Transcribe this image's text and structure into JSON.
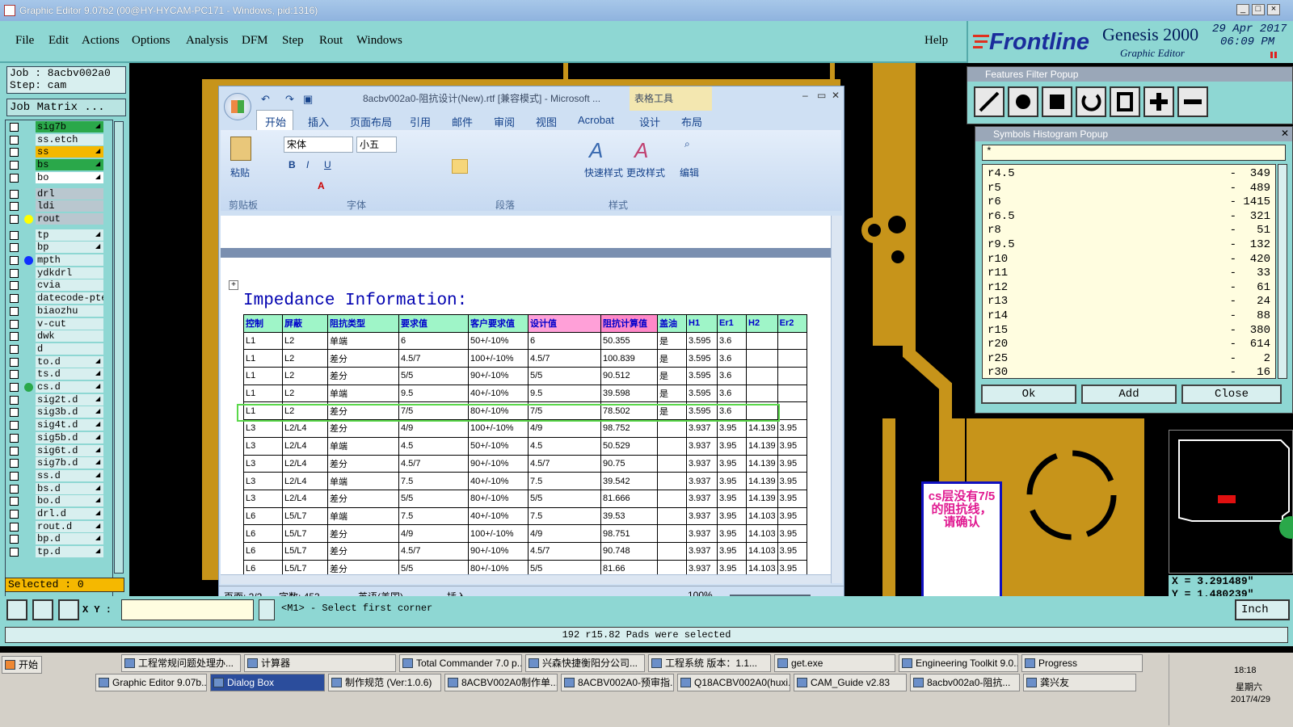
{
  "window": {
    "title": "Graphic Editor 9.07b2 (00@HY-HYCAM-PC171 - Windows, pid:1316)",
    "buttons": [
      "_",
      "□",
      "×"
    ]
  },
  "menu": {
    "items": [
      "File",
      "Edit",
      "Actions",
      "Options",
      "Analysis",
      "DFM",
      "Step",
      "Rout",
      "Windows"
    ],
    "help": "Help"
  },
  "brand": {
    "logo": "Frontline",
    "product": "Genesis 2000",
    "sub": "Graphic Editor",
    "date": "29 Apr 2017",
    "time": "06:09 PM"
  },
  "job": {
    "job": "Job : 8acbv002a0",
    "step": "Step: cam",
    "matrix": "Job Matrix ..."
  },
  "layers": [
    {
      "name": "sig7b",
      "color": "#2aa84a",
      "arrow": true
    },
    {
      "name": "ss.etch",
      "color": "#d8efef",
      "arrow": false
    },
    {
      "name": "ss",
      "color": "#f5b800",
      "arrow": true
    },
    {
      "name": "bs",
      "color": "#2aa84a",
      "arrow": true
    },
    {
      "name": "bo",
      "color": "#ffffff",
      "arrow": true
    },
    {
      "name": "drl",
      "color": "#b9c7cf",
      "arrow": false
    },
    {
      "name": "ldi",
      "color": "#b9c7cf",
      "arrow": false
    },
    {
      "name": "rout",
      "color": "#b9c7cf",
      "arrow": false,
      "dot": "#ffff00"
    },
    {
      "name": "tp",
      "color": "#d8efef",
      "arrow": true
    },
    {
      "name": "bp",
      "color": "#d8efef",
      "arrow": true
    },
    {
      "name": "mpth",
      "color": "#d8efef",
      "arrow": false,
      "dot": "#1030ff"
    },
    {
      "name": "ydkdrl",
      "color": "#d8efef",
      "arrow": false
    },
    {
      "name": "cvia",
      "color": "#d8efef",
      "arrow": false
    },
    {
      "name": "datecode-pte",
      "color": "#d8efef",
      "arrow": false
    },
    {
      "name": "biaozhu",
      "color": "#d8efef",
      "arrow": false
    },
    {
      "name": "v-cut",
      "color": "#d8efef",
      "arrow": false
    },
    {
      "name": "dwk",
      "color": "#d8efef",
      "arrow": false
    },
    {
      "name": "d",
      "color": "#d8efef",
      "arrow": false
    },
    {
      "name": "to.d",
      "color": "#d8efef",
      "arrow": true
    },
    {
      "name": "ts.d",
      "color": "#d8efef",
      "arrow": true
    },
    {
      "name": "cs.d",
      "color": "#d8efef",
      "arrow": true,
      "dot": "#2aa84a"
    },
    {
      "name": "sig2t.d",
      "color": "#d8efef",
      "arrow": true
    },
    {
      "name": "sig3b.d",
      "color": "#d8efef",
      "arrow": true
    },
    {
      "name": "sig4t.d",
      "color": "#d8efef",
      "arrow": true
    },
    {
      "name": "sig5b.d",
      "color": "#d8efef",
      "arrow": true
    },
    {
      "name": "sig6t.d",
      "color": "#d8efef",
      "arrow": true
    },
    {
      "name": "sig7b.d",
      "color": "#d8efef",
      "arrow": true
    },
    {
      "name": "ss.d",
      "color": "#d8efef",
      "arrow": true
    },
    {
      "name": "bs.d",
      "color": "#d8efef",
      "arrow": true
    },
    {
      "name": "bo.d",
      "color": "#d8efef",
      "arrow": true
    },
    {
      "name": "drl.d",
      "color": "#d8efef",
      "arrow": true
    },
    {
      "name": "rout.d",
      "color": "#d8efef",
      "arrow": true
    },
    {
      "name": "bp.d",
      "color": "#d8efef",
      "arrow": true
    },
    {
      "name": "tp.d",
      "color": "#d8efef",
      "arrow": true
    }
  ],
  "selected": "Selected : 0",
  "word": {
    "title": "8acbv002a0-阻抗设计(New).rtf [兼容模式] - Microsoft ...",
    "context": "表格工具",
    "tabs": [
      "开始",
      "插入",
      "页面布局",
      "引用",
      "邮件",
      "审阅",
      "视图",
      "Acrobat",
      "设计",
      "布局"
    ],
    "font": "宋体",
    "size": "小五",
    "paste": "粘贴",
    "quickstyle": "快速样式",
    "changestyle": "更改样式",
    "edit": "编辑",
    "groups": [
      "剪贴板",
      "字体",
      "段落",
      "样式"
    ],
    "heading": "Impedance Information:",
    "status": {
      "page": "页面: 2/2",
      "words": "字数: 453",
      "lang": "英语(美国)",
      "mode": "插入",
      "zoom": "100%"
    }
  },
  "table": {
    "headers": [
      "控制",
      "屏蔽",
      "阻抗类型",
      "要求值",
      "客户要求值",
      "设计值",
      "阻抗计算值",
      "盖油",
      "H1",
      "Er1",
      "H2",
      "Er2"
    ],
    "rows": [
      [
        "L1",
        "L2",
        "单端",
        "6",
        "50+/-10%",
        "6",
        "50.355",
        "是",
        "3.595",
        "3.6",
        "",
        ""
      ],
      [
        "L1",
        "L2",
        "差分",
        "4.5/7",
        "100+/-10%",
        "4.5/7",
        "100.839",
        "是",
        "3.595",
        "3.6",
        "",
        ""
      ],
      [
        "L1",
        "L2",
        "差分",
        "5/5",
        "90+/-10%",
        "5/5",
        "90.512",
        "是",
        "3.595",
        "3.6",
        "",
        ""
      ],
      [
        "L1",
        "L2",
        "单端",
        "9.5",
        "40+/-10%",
        "9.5",
        "39.598",
        "是",
        "3.595",
        "3.6",
        "",
        ""
      ],
      [
        "L1",
        "L2",
        "差分",
        "7/5",
        "80+/-10%",
        "7/5",
        "78.502",
        "是",
        "3.595",
        "3.6",
        "",
        ""
      ],
      [
        "L3",
        "L2/L4",
        "差分",
        "4/9",
        "100+/-10%",
        "4/9",
        "98.752",
        "",
        "3.937",
        "3.95",
        "14.139",
        "3.95"
      ],
      [
        "L3",
        "L2/L4",
        "单端",
        "4.5",
        "50+/-10%",
        "4.5",
        "50.529",
        "",
        "3.937",
        "3.95",
        "14.139",
        "3.95"
      ],
      [
        "L3",
        "L2/L4",
        "差分",
        "4.5/7",
        "90+/-10%",
        "4.5/7",
        "90.75",
        "",
        "3.937",
        "3.95",
        "14.139",
        "3.95"
      ],
      [
        "L3",
        "L2/L4",
        "单端",
        "7.5",
        "40+/-10%",
        "7.5",
        "39.542",
        "",
        "3.937",
        "3.95",
        "14.139",
        "3.95"
      ],
      [
        "L3",
        "L2/L4",
        "差分",
        "5/5",
        "80+/-10%",
        "5/5",
        "81.666",
        "",
        "3.937",
        "3.95",
        "14.139",
        "3.95"
      ],
      [
        "L6",
        "L5/L7",
        "单端",
        "7.5",
        "40+/-10%",
        "7.5",
        "39.53",
        "",
        "3.937",
        "3.95",
        "14.103",
        "3.95"
      ],
      [
        "L6",
        "L5/L7",
        "差分",
        "4/9",
        "100+/-10%",
        "4/9",
        "98.751",
        "",
        "3.937",
        "3.95",
        "14.103",
        "3.95"
      ],
      [
        "L6",
        "L5/L7",
        "差分",
        "4.5/7",
        "90+/-10%",
        "4.5/7",
        "90.748",
        "",
        "3.937",
        "3.95",
        "14.103",
        "3.95"
      ],
      [
        "L6",
        "L5/L7",
        "差分",
        "5/5",
        "80+/-10%",
        "5/5",
        "81.66",
        "",
        "3.937",
        "3.95",
        "14.103",
        "3.95"
      ]
    ]
  },
  "filter": {
    "title": "Features Filter Popup"
  },
  "histogram": {
    "title": "Symbols Histogram Popup",
    "filter": "*",
    "items": [
      [
        "r4.5",
        "349"
      ],
      [
        "r5",
        "489"
      ],
      [
        "r6",
        "1415"
      ],
      [
        "r6.5",
        "321"
      ],
      [
        "r8",
        "51"
      ],
      [
        "r9.5",
        "132"
      ],
      [
        "r10",
        "420"
      ],
      [
        "r11",
        "33"
      ],
      [
        "r12",
        "61"
      ],
      [
        "r13",
        "24"
      ],
      [
        "r14",
        "88"
      ],
      [
        "r15",
        "380"
      ],
      [
        "r20",
        "614"
      ],
      [
        "r25",
        "2"
      ],
      [
        "r30",
        "16"
      ]
    ],
    "buttons": [
      "Ok",
      "Add",
      "Close"
    ]
  },
  "coords": {
    "x": "X = 3.291489\"",
    "y": "Y = 1.480239\""
  },
  "note": "cs层没有7/5的阻抗线，请确认",
  "prompt": {
    "xy": "X Y :",
    "msg": "<M1> - Select first corner",
    "unit": "Inch"
  },
  "message": "192 r15.82 Pads were selected",
  "taskbar": {
    "start": "开始",
    "row1": [
      "工程常规问题处理办...",
      "计算器",
      "Total Commander 7.0 p...",
      "兴森快捷衡阳分公司...",
      "工程系统  版本：1.1...",
      "get.exe",
      "Engineering Toolkit 9.0...",
      "Progress"
    ],
    "row2": [
      "Graphic Editor 9.07b...",
      "Dialog Box",
      "制作规范 (Ver:1.0.6)",
      "8ACBV002A0制作单...",
      "8ACBV002A0-预审指...",
      "Q18ACBV002A0(huxi...",
      "CAM_Guide v2.83",
      "8acbv002a0-阻抗...",
      "龚兴友"
    ],
    "clock": "18:18",
    "day": "星期六",
    "date": "2017/4/29"
  }
}
